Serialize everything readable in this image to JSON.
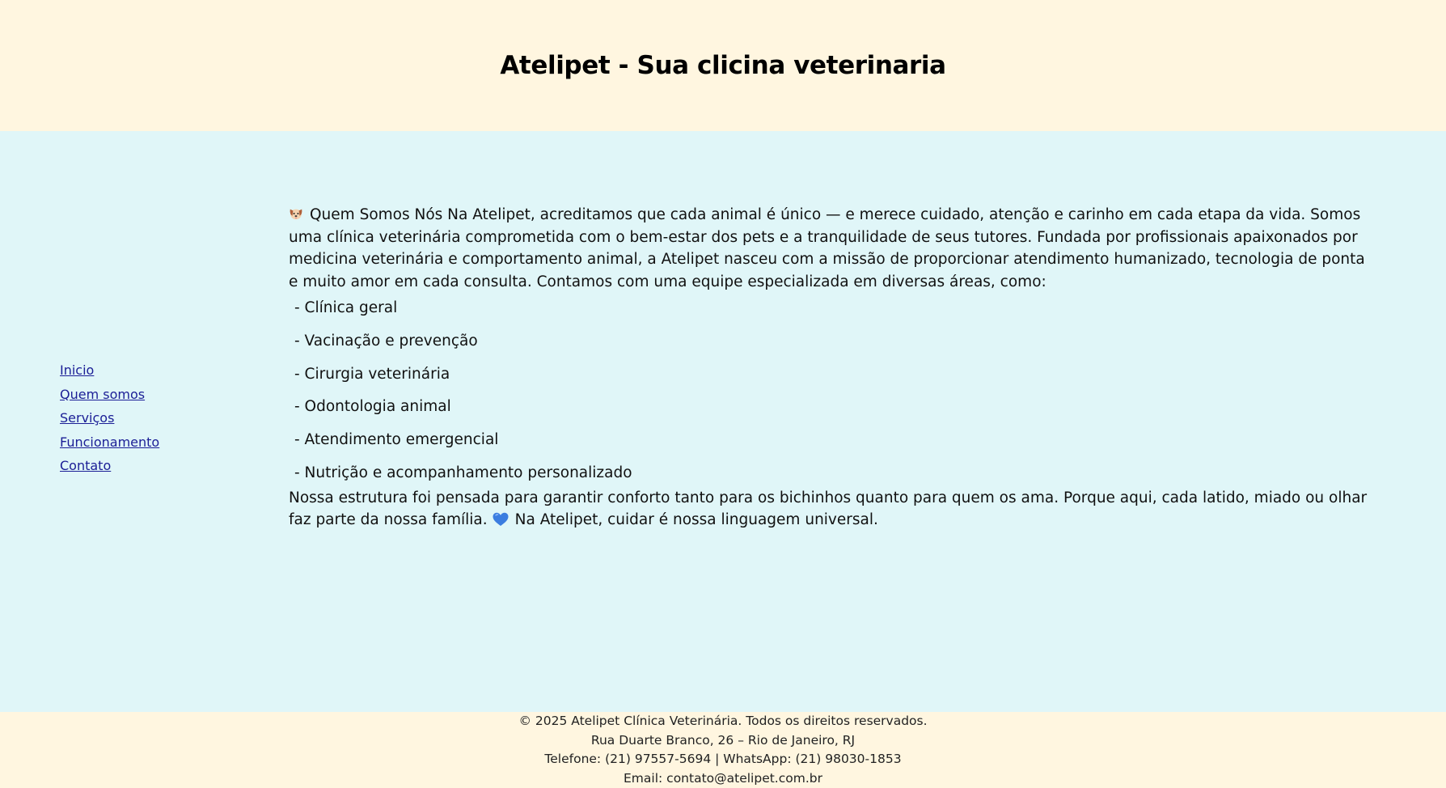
{
  "header": {
    "title": "Atelipet - Sua clicina veterinaria"
  },
  "nav": {
    "items": [
      {
        "label": "Inicio"
      },
      {
        "label": "Quem somos"
      },
      {
        "label": "Serviços"
      },
      {
        "label": "Funcionamento"
      },
      {
        "label": "Contato"
      }
    ],
    "link_color": "#1b1e96"
  },
  "about": {
    "icon": "dog-face-icon",
    "intro": "Quem Somos Nós Na Atelipet, acreditamos que cada animal é único — e merece cuidado, atenção e carinho em cada etapa da vida. Somos uma clínica veterinária comprometida com o bem-estar dos pets e a tranquilidade de seus tutores. Fundada por profissionais apaixonados por medicina veterinária e comportamento animal, a Atelipet nasceu com a missão de proporcionar atendimento humanizado, tecnologia de ponta e muito amor em cada consulta. Contamos com uma equipe especializada em diversas áreas, como:",
    "services": [
      "- Clínica geral",
      "- Vacinação e prevenção",
      "- Cirurgia veterinária",
      "- Odontologia animal",
      "- Atendimento emergencial",
      "- Nutrição e acompanhamento personalizado"
    ],
    "closing_before": "Nossa estrutura foi pensada para garantir conforto tanto para os bichinhos quanto para quem os ama. Porque aqui, cada latido, miado ou olhar faz parte da nossa família.",
    "heart_icon": "blue-heart-icon",
    "closing_after": "Na Atelipet, cuidar é nossa linguagem universal."
  },
  "footer": {
    "copyright": "© 2025 Atelipet Clínica Veterinária. Todos os direitos reservados.",
    "address": "Rua Duarte Branco, 26 – Rio de Janeiro, RJ",
    "phones": "Telefone: (21) 97557-5694 | WhatsApp: (21) 98030-1853",
    "email": "Email: contato@atelipet.com.br"
  },
  "colors": {
    "header_bg": "#fff6e0",
    "main_bg": "#e0f6f8",
    "footer_bg": "#fff6e0"
  }
}
